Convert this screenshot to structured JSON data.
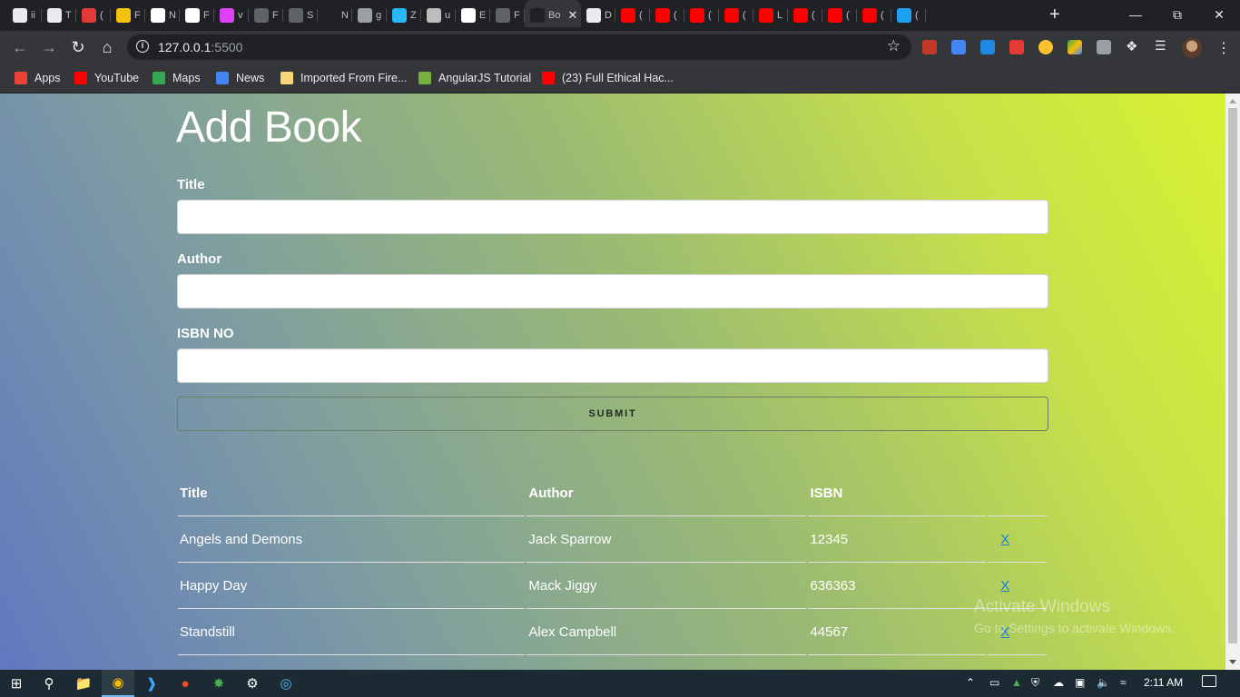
{
  "browser": {
    "tabs": [
      {
        "title": "ii",
        "icon_color": "#e8eaed"
      },
      {
        "title": "T",
        "icon_color": "#e8eaed"
      },
      {
        "title": "(",
        "icon_color": "#e53935"
      },
      {
        "title": "F",
        "icon_color": "#f4c20d"
      },
      {
        "title": "N",
        "icon_color": "#ffffff"
      },
      {
        "title": "F",
        "icon_color": "#ffffff"
      },
      {
        "title": "v",
        "icon_color": "#e040fb"
      },
      {
        "title": "F",
        "icon_color": "#5f6368"
      },
      {
        "title": "S",
        "icon_color": "#5f6368"
      },
      {
        "title": "N",
        "icon_color": "#202124"
      },
      {
        "title": "g",
        "icon_color": "#9aa0a6"
      },
      {
        "title": "Z",
        "icon_color": "#29b6f6"
      },
      {
        "title": "u",
        "icon_color": "#bdbdbd"
      },
      {
        "title": "E",
        "icon_color": "#ffffff"
      },
      {
        "title": "F",
        "icon_color": "#5f6368"
      }
    ],
    "active_tab": {
      "title": "Bo",
      "icon_color": "#202124"
    },
    "tabs_after": [
      {
        "title": "D",
        "icon_color": "#e8eaed"
      },
      {
        "title": "(",
        "icon_color": "#ff0000"
      },
      {
        "title": "(",
        "icon_color": "#ff0000"
      },
      {
        "title": "(",
        "icon_color": "#ff0000"
      },
      {
        "title": "(",
        "icon_color": "#ff0000"
      },
      {
        "title": "L",
        "icon_color": "#ff0000"
      },
      {
        "title": "(",
        "icon_color": "#ff0000"
      },
      {
        "title": "(",
        "icon_color": "#ff0000"
      },
      {
        "title": "(",
        "icon_color": "#ff0000"
      },
      {
        "title": "(",
        "icon_color": "#1da1f2"
      }
    ],
    "url_host": "127.0.0.1",
    "url_port": ":5500"
  },
  "bookmarks": [
    {
      "label": "Apps",
      "icon": "apps-grid-icon",
      "color": "#ea4335"
    },
    {
      "label": "YouTube",
      "icon": "youtube-icon",
      "color": "#ff0000"
    },
    {
      "label": "Maps",
      "icon": "maps-icon",
      "color": "#34a853"
    },
    {
      "label": "News",
      "icon": "news-icon",
      "color": "#4285f4"
    },
    {
      "label": "Imported From Fire...",
      "icon": "folder-icon",
      "color": "#f9d67a"
    },
    {
      "label": "AngularJS Tutorial",
      "icon": "tutorial-icon",
      "color": "#76b041"
    },
    {
      "label": "(23) Full Ethical Hac...",
      "icon": "youtube-icon",
      "color": "#ff0000"
    }
  ],
  "page": {
    "heading": "Add Book",
    "form": {
      "title_label": "Title",
      "title_value": "",
      "author_label": "Author",
      "author_value": "",
      "isbn_label": "ISBN NO",
      "isbn_value": "",
      "submit_label": "SUBMIT"
    },
    "table": {
      "headers": [
        "Title",
        "Author",
        "ISBN",
        ""
      ],
      "rows": [
        {
          "title": "Angels and Demons",
          "author": "Jack Sparrow",
          "isbn": "12345",
          "delete": "X"
        },
        {
          "title": "Happy Day",
          "author": "Mack Jiggy",
          "isbn": "636363",
          "delete": "X"
        },
        {
          "title": "Standstill",
          "author": "Alex Campbell",
          "isbn": "44567",
          "delete": "X"
        }
      ]
    }
  },
  "watermark": {
    "line1": "Activate Windows",
    "line2": "Go to Settings to activate Windows."
  },
  "taskbar": {
    "time": "2:11 AM"
  }
}
